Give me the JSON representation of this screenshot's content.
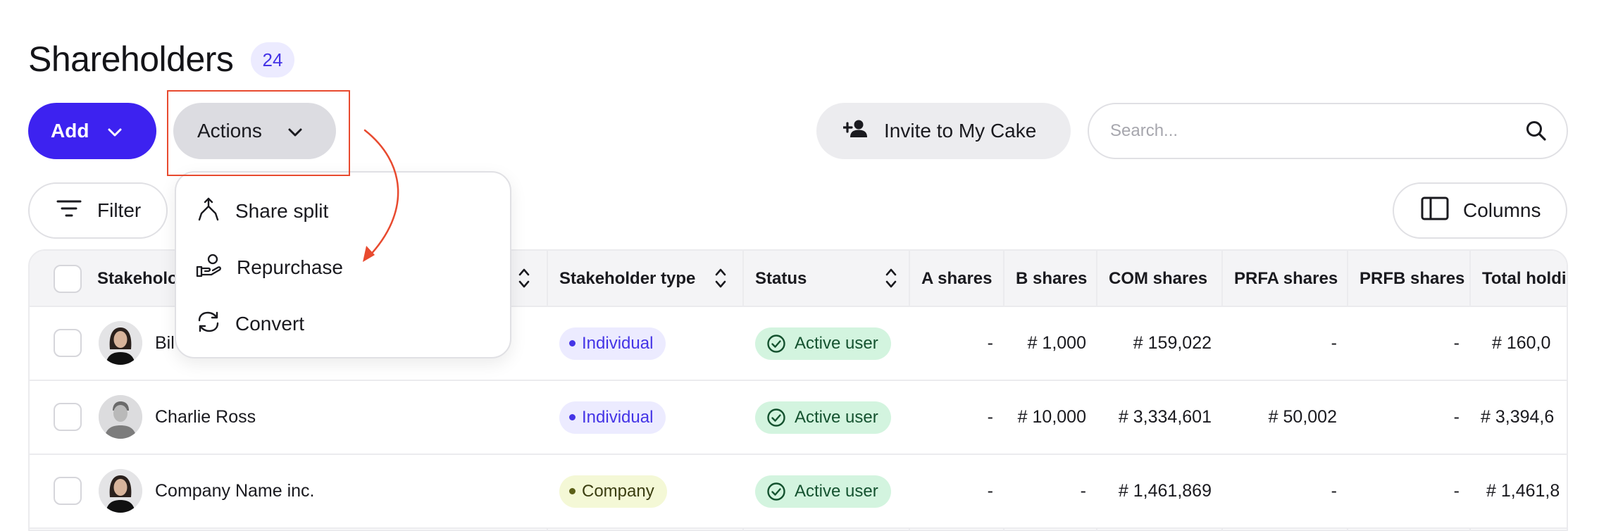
{
  "header": {
    "title": "Shareholders",
    "count": "24"
  },
  "toolbar": {
    "add_label": "Add",
    "actions_label": "Actions",
    "invite_label": "Invite to My Cake",
    "search_placeholder": "Search...",
    "filter_label": "Filter",
    "columns_label": "Columns"
  },
  "actions_menu": {
    "items": [
      {
        "label": "Share split",
        "icon": "share-split-icon"
      },
      {
        "label": "Repurchase",
        "icon": "repurchase-icon"
      },
      {
        "label": "Convert",
        "icon": "convert-icon"
      }
    ]
  },
  "annotation": {
    "highlight_color": "#e84a2f"
  },
  "table": {
    "columns": [
      "Stakeholder",
      "Stakeholder type",
      "Status",
      "A shares",
      "B shares",
      "COM shares",
      "PRFA shares",
      "PRFB shares",
      "Total holdings"
    ],
    "column_header_visible": {
      "stakeholder": "Stakeholo",
      "total": "Total holdi"
    },
    "rows": [
      {
        "name": "Bil",
        "type": "Individual",
        "status": "Active user",
        "a": "-",
        "b": "# 1,000",
        "com": "# 159,022",
        "prfa": "-",
        "prfb": "-",
        "total": "# 160,0"
      },
      {
        "name": "Charlie Ross",
        "type": "Individual",
        "status": "Active user",
        "a": "-",
        "b": "# 10,000",
        "com": "# 3,334,601",
        "prfa": "# 50,002",
        "prfb": "-",
        "total": "# 3,394,6"
      },
      {
        "name": "Company Name inc.",
        "type": "Company",
        "status": "Active user",
        "a": "-",
        "b": "-",
        "com": "# 1,461,869",
        "prfa": "-",
        "prfb": "-",
        "total": "# 1,461,8"
      }
    ]
  },
  "colors": {
    "accent": "#3d22f0",
    "badge_bg": "#ecebff",
    "individual": "#4434e6",
    "company_bg": "#f4f8d6",
    "active_bg": "#d3f4df",
    "active_text": "#14522f"
  }
}
